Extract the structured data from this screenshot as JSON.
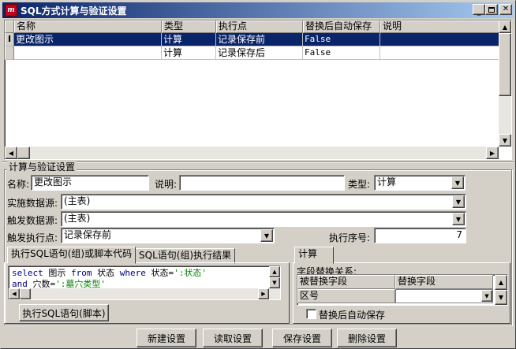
{
  "window": {
    "title": "SQL方式计算与验证设置"
  },
  "grid": {
    "columns": [
      "名称",
      "类型",
      "执行点",
      "替换后自动保存",
      "说明"
    ],
    "rows": [
      {
        "indicator": "I",
        "name": "更改图示",
        "type": "计算",
        "exec_point": "记录保存前",
        "auto_save": "False",
        "desc": ""
      },
      {
        "indicator": "",
        "name": "",
        "type": "计算",
        "exec_point": "记录保存后",
        "auto_save": "False",
        "desc": ""
      }
    ]
  },
  "settings": {
    "group_label": "计算与验证设置",
    "name_label": "名称:",
    "name_value": "更改图示",
    "desc_label": "说明:",
    "desc_value": "",
    "type_label": "类型:",
    "type_value": "计算",
    "impl_source_label": "实施数据源:",
    "impl_source_value": "(主表)",
    "trigger_source_label": "触发数据源:",
    "trigger_source_value": "(主表)",
    "trigger_point_label": "触发执行点:",
    "trigger_point_value": "记录保存前",
    "exec_order_label": "执行序号:",
    "exec_order_value": "7"
  },
  "left_tabs": {
    "tab1": "执行SQL语句(组)或脚本代码",
    "tab2": "SQL语句(组)执行结果",
    "code": {
      "line1": {
        "kw1": "select",
        "t1": " 图示 ",
        "kw2": "from",
        "t2": " 状态 ",
        "kw3": "where",
        "t3": " 状态=",
        "s1": "':状态'"
      },
      "line2": {
        "kw1": "and",
        "t1": " 穴数=",
        "s1": "':墓穴类型'"
      }
    },
    "exec_button": "执行SQL语句(脚本)"
  },
  "right_tab": {
    "tab": "计算",
    "field_replace_label": "字段替换关系:",
    "col1": "被替换字段",
    "col2": "替换字段",
    "row1_col1": "区号",
    "row1_col2": "",
    "auto_save_label": "替换后自动保存",
    "auto_save_checked": false
  },
  "buttons": {
    "new": "新建设置",
    "read": "读取设置",
    "save": "保存设置",
    "delete": "删除设置"
  }
}
